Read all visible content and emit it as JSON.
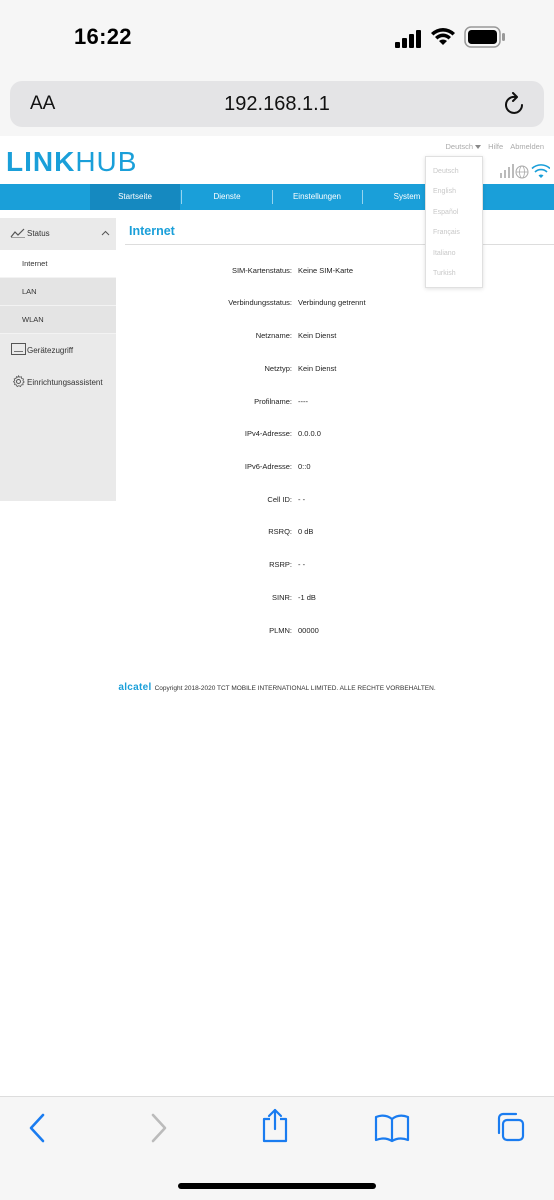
{
  "status_bar": {
    "time": "16:22"
  },
  "browser": {
    "text_size_label": "AA",
    "url": "192.168.1.1"
  },
  "header": {
    "logo_link": "LINK",
    "logo_hub": "HUB",
    "language": "Deutsch",
    "help": "Hilfe",
    "logout": "Abmelden"
  },
  "language_dropdown": [
    "Deutsch",
    "English",
    "Español",
    "Français",
    "Italiano",
    "Turkish"
  ],
  "nav": {
    "items": [
      "Startseite",
      "Dienste",
      "Einstellungen",
      "System"
    ],
    "active_index": 0
  },
  "sidebar": {
    "status_label": "Status",
    "sub_items": [
      "Internet",
      "LAN",
      "WLAN"
    ],
    "active_sub": 0,
    "device_access_label": "Gerätezugriff",
    "wizard_label": "Einrichtungsassistent"
  },
  "content": {
    "title": "Internet",
    "rows": [
      {
        "label": "SIM-Kartenstatus:",
        "value": "Keine SIM-Karte"
      },
      {
        "label": "Verbindungsstatus:",
        "value": "Verbindung getrennt"
      },
      {
        "label": "Netzname:",
        "value": "Kein Dienst"
      },
      {
        "label": "Netztyp:",
        "value": "Kein Dienst"
      },
      {
        "label": "Profilname:",
        "value": "----"
      },
      {
        "label": "IPv4-Adresse:",
        "value": "0.0.0.0"
      },
      {
        "label": "IPv6-Adresse:",
        "value": "0::0"
      },
      {
        "label": "Cell ID:",
        "value": "- -"
      },
      {
        "label": "RSRQ:",
        "value": "0 dB"
      },
      {
        "label": "RSRP:",
        "value": "- -"
      },
      {
        "label": "SINR:",
        "value": "-1 dB"
      },
      {
        "label": "PLMN:",
        "value": "00000"
      }
    ]
  },
  "footer": {
    "brand": "alcatel",
    "copyright": "Copyright 2018-2020 TCT MOBILE INTERNATIONAL LIMITED. ALLE RECHTE VORBEHALTEN."
  },
  "colors": {
    "accent": "#1a9fd9",
    "nav_active": "#1589c0",
    "sidebar_bg": "#eaeaea"
  }
}
